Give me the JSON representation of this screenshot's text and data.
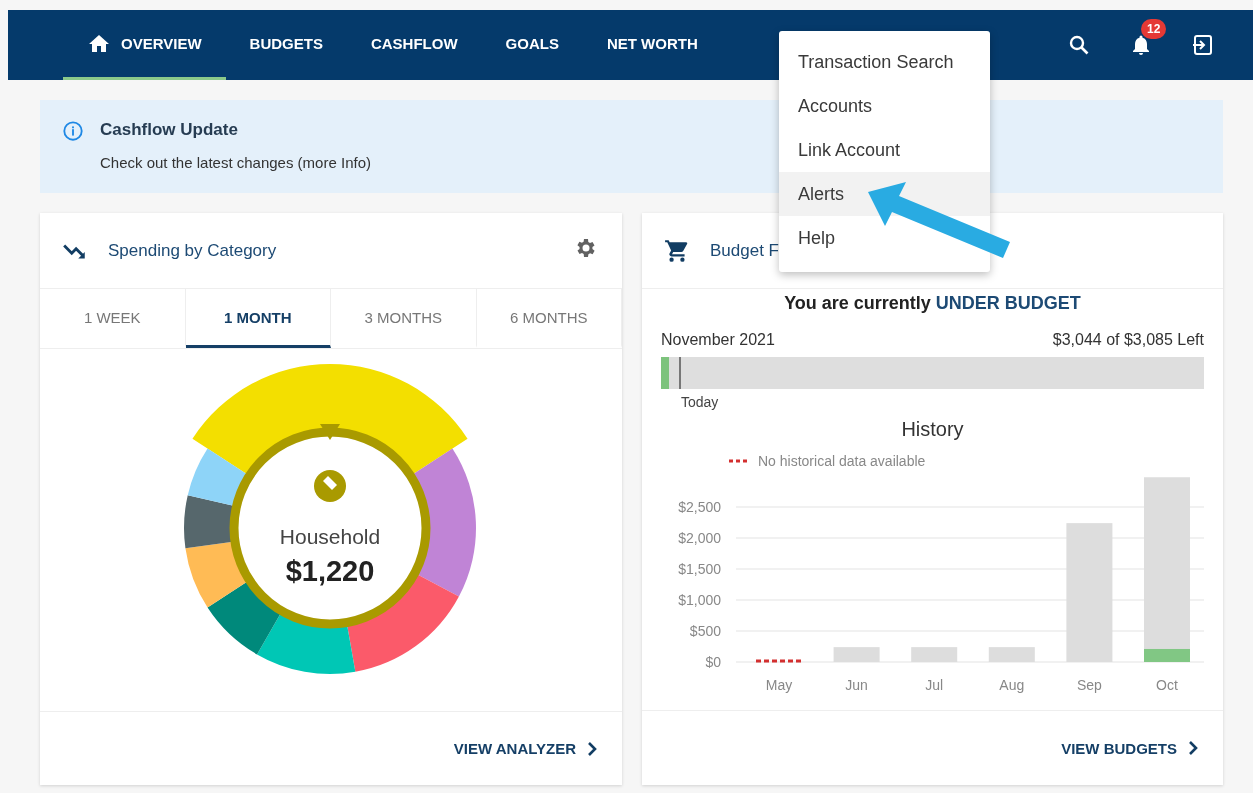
{
  "nav": {
    "items": [
      {
        "label": "OVERVIEW",
        "selected": true,
        "kind": "home"
      },
      {
        "label": "BUDGETS",
        "selected": false
      },
      {
        "label": "CASHFLOW",
        "selected": false
      },
      {
        "label": "GOALS",
        "selected": false
      },
      {
        "label": "NET WORTH",
        "selected": false
      }
    ],
    "notification_count": "12"
  },
  "menu": {
    "items": [
      {
        "label": "Transaction Search",
        "selected": false
      },
      {
        "label": "Accounts",
        "selected": false
      },
      {
        "label": "Link Account",
        "selected": false
      },
      {
        "label": "Alerts",
        "selected": true
      },
      {
        "label": "Help",
        "selected": false
      }
    ]
  },
  "banner": {
    "title": "Cashflow Update",
    "text": "Check out the latest changes (more Info)"
  },
  "spending_card": {
    "title": "Spending by Category",
    "tabs": [
      {
        "label": "1 WEEK",
        "selected": false
      },
      {
        "label": "1 MONTH",
        "selected": true
      },
      {
        "label": "3 MONTHS",
        "selected": false
      },
      {
        "label": "6 MONTHS",
        "selected": false
      }
    ],
    "center_label": "Household",
    "center_value": "$1,220",
    "link": "VIEW ANALYZER"
  },
  "budget_card": {
    "title": "Budget F",
    "status_prefix": "You are currently",
    "status": "UNDER BUDGET",
    "month": "November 2021",
    "remaining": "$3,044 of $3,085 Left",
    "level": 0.015,
    "today_label": "Today",
    "history_title": "History",
    "legend": "No historical data available",
    "link": "VIEW BUDGETS",
    "chart_data": {
      "type": "bar",
      "categories": [
        "May",
        "Jun",
        "Jul",
        "Aug",
        "Sep",
        "Oct"
      ],
      "series": [
        {
          "color": "#dddddd",
          "values": [
            null,
            240,
            240,
            240,
            2240,
            2980
          ]
        },
        {
          "color": "#81c784",
          "values": [
            null,
            null,
            null,
            null,
            null,
            210
          ]
        }
      ],
      "grid": true,
      "ylim": [
        0,
        3000
      ],
      "yticks": [
        {
          "value": 0,
          "label": "$0"
        },
        {
          "value": 500,
          "label": "$500"
        },
        {
          "value": 1000,
          "label": "$1,000"
        },
        {
          "value": 1500,
          "label": "$1,500"
        },
        {
          "value": 2000,
          "label": "$2,000"
        },
        {
          "value": 2500,
          "label": "$2,500"
        }
      ]
    }
  }
}
